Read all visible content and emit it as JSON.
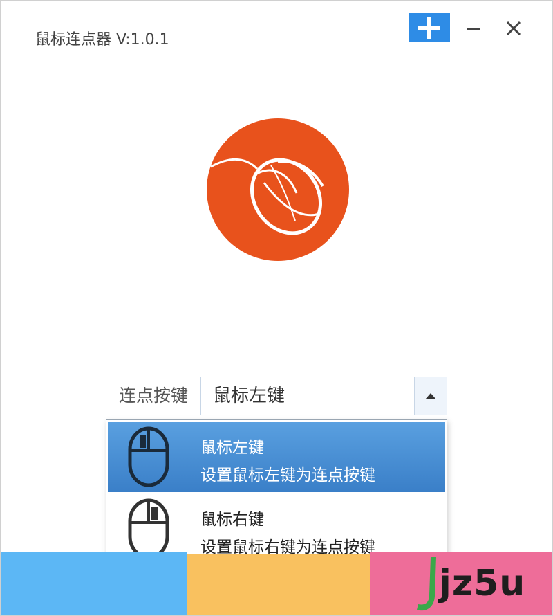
{
  "window": {
    "title": "鼠标连点器 V:1.0.1"
  },
  "titlebar": {
    "buttons": [
      "plus-icon",
      "minimize-icon",
      "close-icon"
    ],
    "accent_color": "#2e8ce6"
  },
  "logo": {
    "icon": "mouse-logo-icon",
    "color": "#e8521c"
  },
  "combo": {
    "label": "连点按键",
    "value": "鼠标左键",
    "arrow_icon": "caret-up-icon"
  },
  "dropdown": {
    "options": [
      {
        "title": "鼠标左键",
        "description": "设置鼠标左键为连点按键",
        "icon": "mouse-left-button-icon",
        "selected": true
      },
      {
        "title": "鼠标右键",
        "description": "设置鼠标右键为连点按键",
        "icon": "mouse-right-button-icon",
        "selected": false
      }
    ],
    "highlight_color": "#3f86cc"
  },
  "footer": {
    "colors": [
      "#5cb7f5",
      "#f9c15f",
      "#ee6d99"
    ]
  },
  "watermark": {
    "text": "jz5u"
  }
}
